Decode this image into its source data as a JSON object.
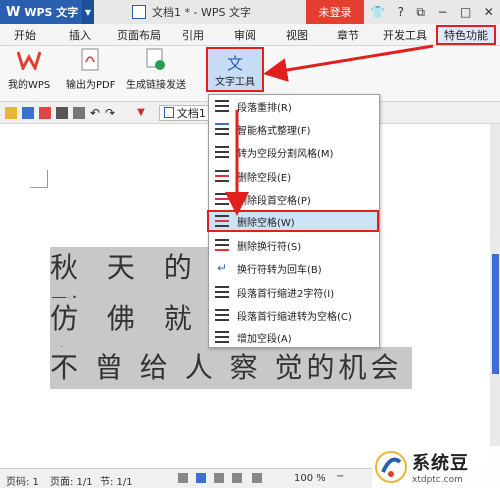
{
  "app": {
    "brand": "WPS 文字",
    "doc_title": "文档1 * - WPS 文字",
    "login": "未登录"
  },
  "menu": {
    "tabs": [
      "开始",
      "插入",
      "页面布局",
      "引用",
      "审阅",
      "视图",
      "章节",
      "开发工具"
    ],
    "special": "特色功能"
  },
  "ribbon": {
    "my_wps": "我的WPS",
    "export_pdf": "输出为PDF",
    "share_link": "生成链接发送",
    "text_tools": "文字工具"
  },
  "quickbar": {
    "doc_tab": "文档1"
  },
  "document": {
    "lines": [
      "秋 天 的 到",
      "仿 佛 就 在",
      "不 曾 给 人 察 觉的机会"
    ]
  },
  "dropdown": {
    "items": [
      "段落重排(R)",
      "智能格式整理(F)",
      "转为空段分割风格(M)",
      "删除空段(E)",
      "删除段首空格(P)",
      "删除空格(W)",
      "删除换行符(S)",
      "换行符转为回车(B)",
      "段落首行缩进2字符(I)",
      "段落首行缩进转为空格(C)",
      "增加空段(A)"
    ]
  },
  "status": {
    "page_num": "页码: 1",
    "page": "页面: 1/1",
    "section": "节: 1/1",
    "zoom": "100 %"
  },
  "watermark": {
    "title": "系统豆",
    "url": "xtdptc.com"
  },
  "colors": {
    "accent_red": "#e0201c",
    "title_red": "#c0392b",
    "wps_blue": "#2a5fb0"
  }
}
